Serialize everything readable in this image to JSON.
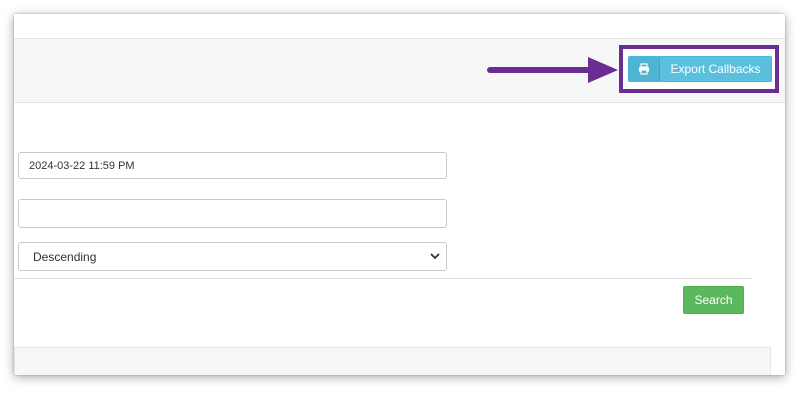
{
  "toolbar": {
    "export_label": "Export Callbacks",
    "export_icon": "printer-icon",
    "highlight_color": "#6a2d91",
    "button_color": "#5bc0de"
  },
  "filters": {
    "date_value": "2024-03-22 11:59 PM",
    "text_value": "",
    "sort_selected": "Descending"
  },
  "actions": {
    "search_label": "Search",
    "search_color": "#5cb85c"
  }
}
